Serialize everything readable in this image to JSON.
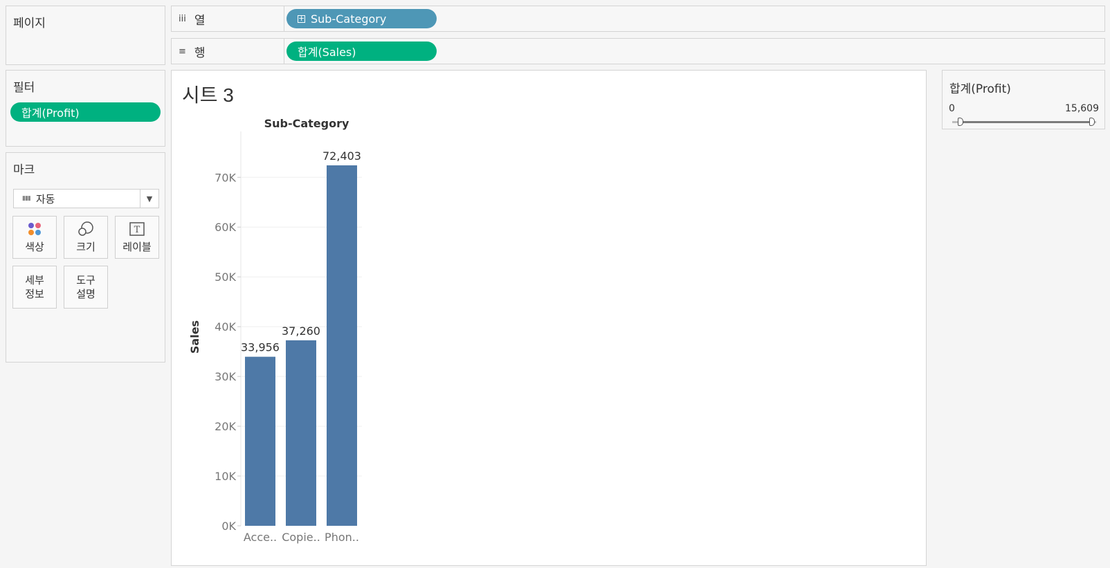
{
  "pages": {
    "title": "페이지"
  },
  "columns_shelf": {
    "label": "열",
    "icon": "iii",
    "pill": "Sub-Category"
  },
  "rows_shelf": {
    "label": "행",
    "icon": "≡",
    "pill": "합계(Sales)"
  },
  "filters": {
    "title": "필터",
    "pill": "합계(Profit)"
  },
  "marks": {
    "title": "마크",
    "type": "자동",
    "buttons": {
      "color": "색상",
      "size": "크기",
      "label": "레이블",
      "detail_1": "세부",
      "detail_2": "정보",
      "tooltip_1": "도구",
      "tooltip_2": "설명"
    }
  },
  "sheet": {
    "title": "시트 3"
  },
  "legend": {
    "title": "합계(Profit)",
    "min": "0",
    "max": "15,609"
  },
  "colors": {
    "bar": "#4e79a7",
    "pill_blue": "#4e97b6",
    "pill_green": "#00b180"
  },
  "chart_data": {
    "type": "bar",
    "title": "Sub-Category",
    "xlabel": "",
    "ylabel": "Sales",
    "categories": [
      "Acce..",
      "Copie..",
      "Phon.."
    ],
    "values": [
      33956,
      37260,
      72403
    ],
    "value_labels": [
      "33,956",
      "37,260",
      "72,403"
    ],
    "ylim": [
      0,
      80000
    ],
    "yticks": [
      0,
      10000,
      20000,
      30000,
      40000,
      50000,
      60000,
      70000
    ],
    "ytick_labels": [
      "0K",
      "10K",
      "20K",
      "30K",
      "40K",
      "50K",
      "60K",
      "70K"
    ],
    "grid": true
  }
}
